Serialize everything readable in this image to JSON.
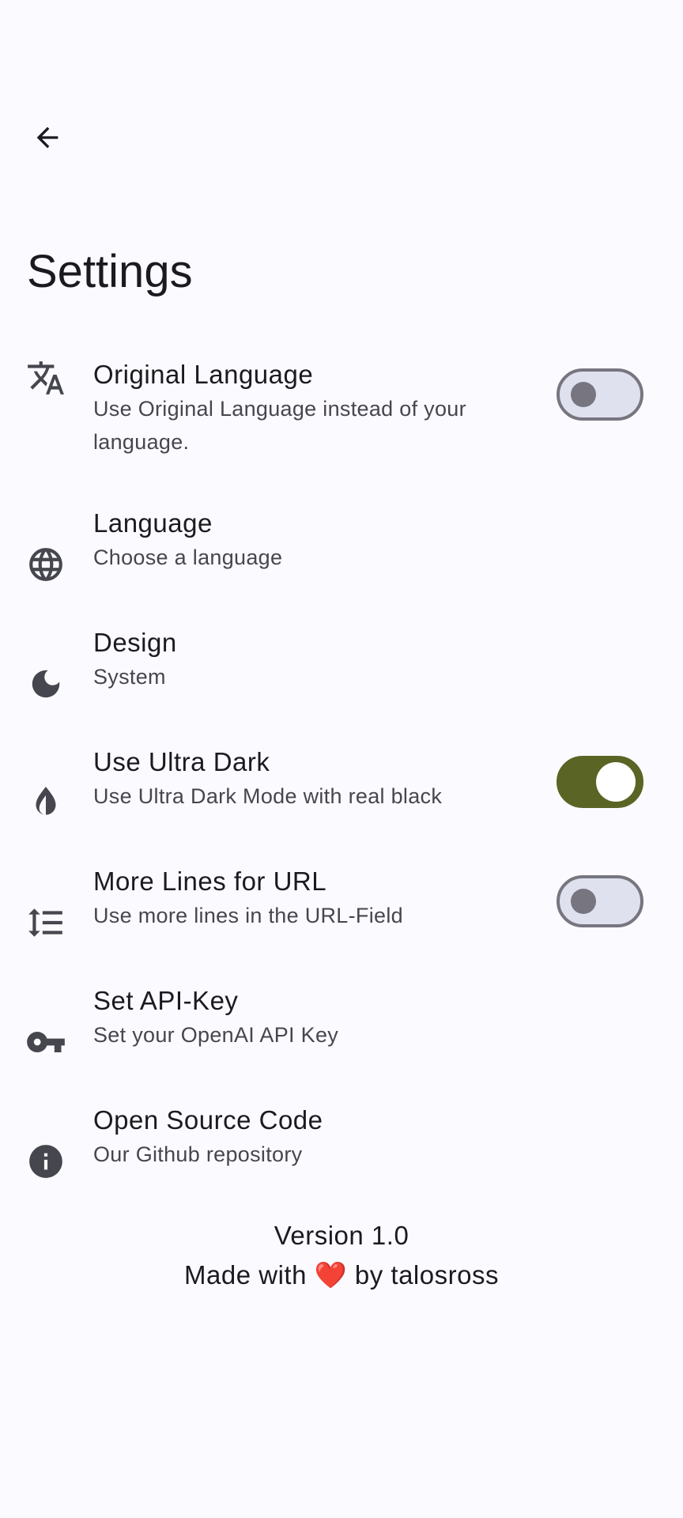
{
  "header": {
    "back_icon": "arrow-back-icon",
    "title": "Settings"
  },
  "colors": {
    "background": "#fbfaff",
    "accent": "#5a6424",
    "switch_off_track": "#dfe1ef",
    "switch_off_outline": "#777680",
    "heart": "#e0252b"
  },
  "settings": [
    {
      "icon": "translate-icon",
      "title": "Original Language",
      "subtitle": "Use Original Language instead of your language.",
      "switch": "off"
    },
    {
      "icon": "globe-icon",
      "title": "Language",
      "subtitle": "Choose a language"
    },
    {
      "icon": "moon-icon",
      "title": "Design",
      "subtitle": "System"
    },
    {
      "icon": "contrast-icon",
      "title": "Use Ultra Dark",
      "subtitle": "Use Ultra Dark Mode with real black",
      "switch": "on"
    },
    {
      "icon": "line-spacing-icon",
      "title": "More Lines for URL",
      "subtitle": "Use more lines in the URL-Field",
      "switch": "off"
    },
    {
      "icon": "key-icon",
      "title": "Set API-Key",
      "subtitle": "Set your OpenAI API Key"
    },
    {
      "icon": "info-icon",
      "title": "Open Source Code",
      "subtitle": "Our Github repository"
    }
  ],
  "footer": {
    "version": "Version 1.0",
    "made_with_prefix": "Made with",
    "heart": "❤️",
    "made_with_suffix": "by talosross"
  }
}
